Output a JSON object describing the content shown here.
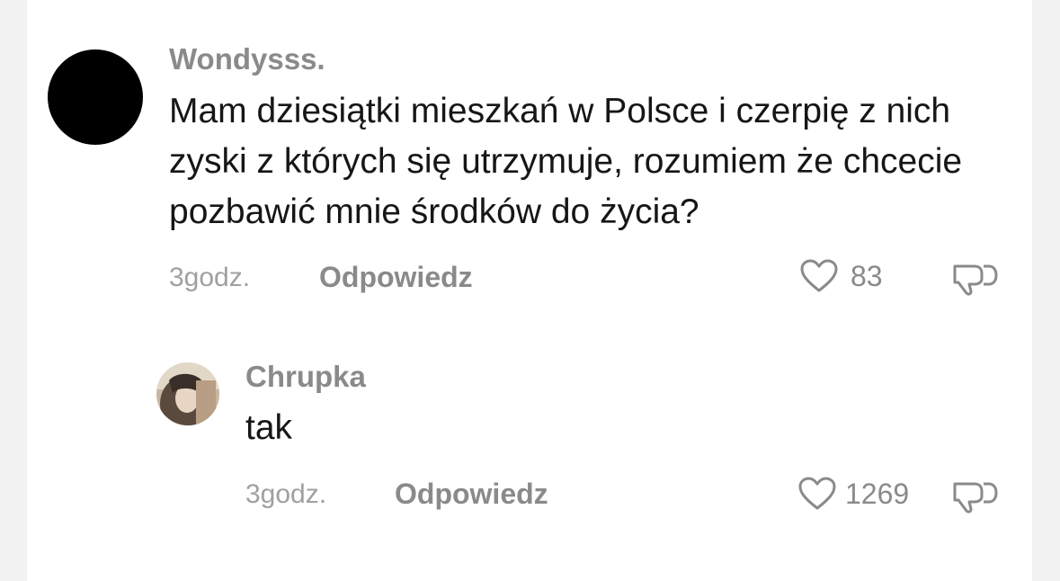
{
  "comments": [
    {
      "username": "Wondysss.",
      "text": "Mam dziesiątki mieszkań w Polsce i czerpię z nich zyski z których się utrzymuje, rozumiem że chcecie pozbawić mnie środków do życia?",
      "time": "3godz.",
      "reply_label": "Odpowiedz",
      "likes": "83",
      "avatar_icon": "black-circle-avatar"
    },
    {
      "username": "Chrupka",
      "text": "tak",
      "time": "3godz.",
      "reply_label": "Odpowiedz",
      "likes": "1269",
      "avatar_icon": "photo-avatar"
    }
  ],
  "icons": {
    "like": "heart-icon",
    "dislike": "thumbs-down-icon"
  }
}
